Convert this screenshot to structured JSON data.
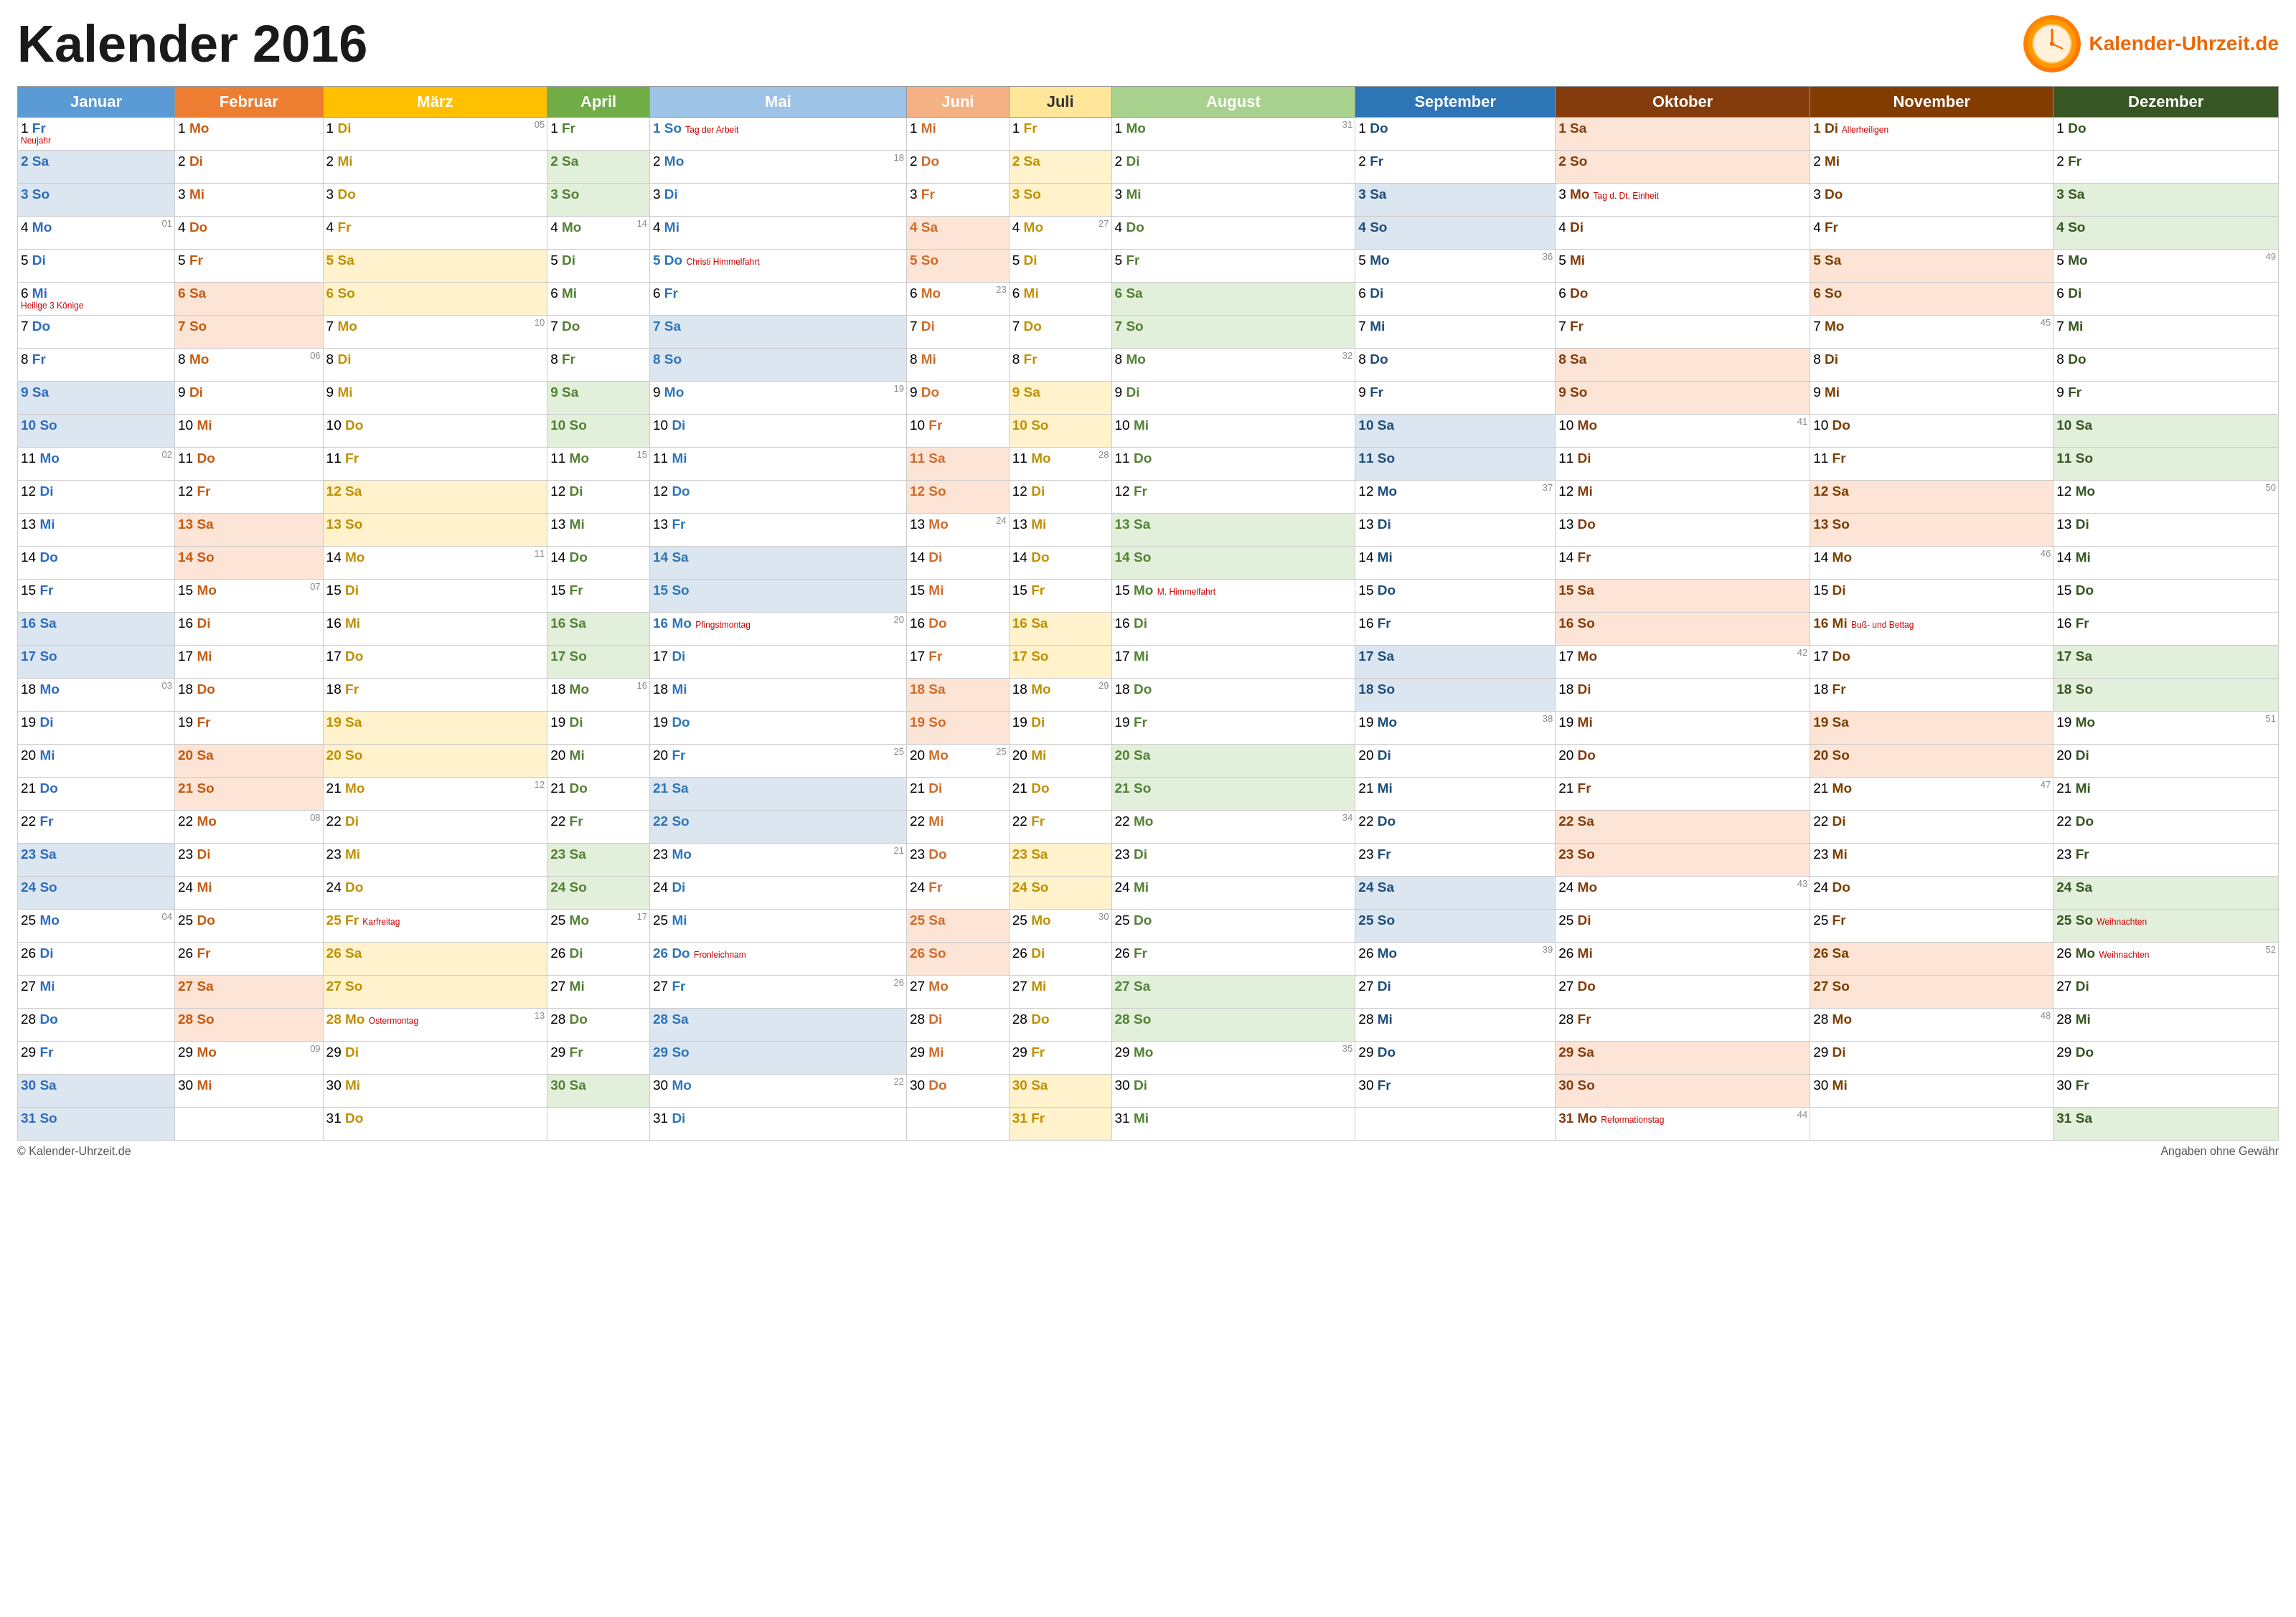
{
  "title": "Kalender 2016",
  "logo": {
    "site": "Kalender-Uhrzeit.de"
  },
  "months": [
    "Januar",
    "Februar",
    "März",
    "April",
    "Mai",
    "Juni",
    "Juli",
    "August",
    "September",
    "Oktober",
    "November",
    "Dezember"
  ],
  "footer": {
    "left": "© Kalender-Uhrzeit.de",
    "right": "Angaben ohne Gewähr"
  }
}
